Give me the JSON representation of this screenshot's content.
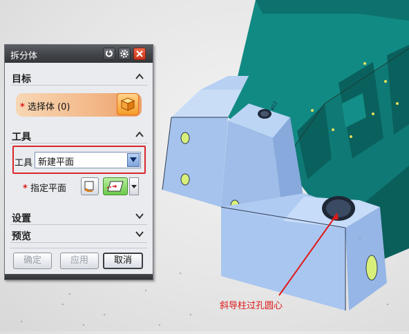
{
  "dialog": {
    "title": "拆分体",
    "sections": {
      "target": {
        "heading": "目标",
        "select_body_label": "选择体 (0)",
        "required_mark": "*"
      },
      "tool": {
        "heading": "工具",
        "tool_label": "工具",
        "tool_value": "新建平面",
        "specify_plane_label": "指定平面",
        "required_mark": "*"
      },
      "settings": {
        "heading": "设置"
      },
      "preview": {
        "heading": "预览"
      }
    },
    "buttons": {
      "ok": "确定",
      "apply": "应用",
      "cancel": "取消"
    }
  },
  "annotation": {
    "text": "斜导柱过孔圆心",
    "color": "#e01818"
  },
  "colors": {
    "model_teal": "#0f7f7a",
    "model_light_blue": "#a9c9f2",
    "highlight_red": "#d9262b",
    "select_orange": "#f3b98a"
  },
  "icons": {
    "reset": "undo-icon",
    "settings": "gear-icon",
    "close": "close-icon",
    "select_body": "cube-icon",
    "plane_dialog": "plane-dialog-icon",
    "plane_inferred": "plane-icon"
  }
}
